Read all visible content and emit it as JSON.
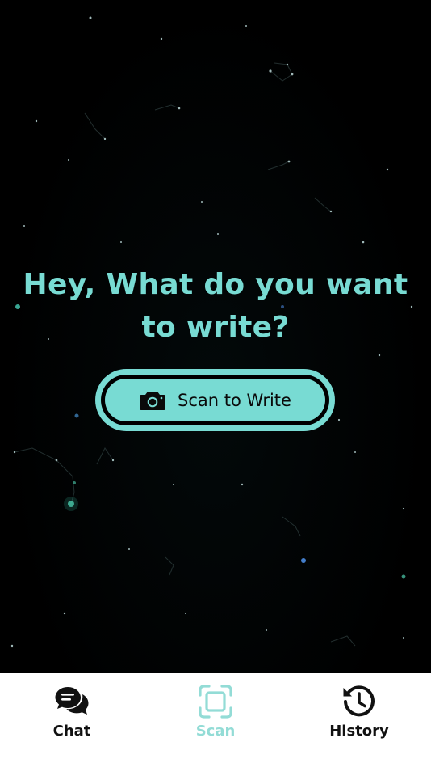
{
  "main": {
    "headline_line1": "Hey, What do you want",
    "headline_line2": "to write?",
    "scan_button_label": "Scan to Write",
    "scan_button_icon": "camera-icon"
  },
  "bottom_nav": {
    "items": [
      {
        "label": "Chat",
        "icon": "chat-bubbles-icon",
        "active": false
      },
      {
        "label": "Scan",
        "icon": "scan-frame-icon",
        "active": true
      },
      {
        "label": "History",
        "icon": "history-clock-icon",
        "active": false
      }
    ]
  },
  "colors": {
    "accent": "#78dbd3",
    "active_nav": "#93dcd6",
    "background": "#000000",
    "nav_background": "#ffffff",
    "nav_text": "#111111"
  }
}
